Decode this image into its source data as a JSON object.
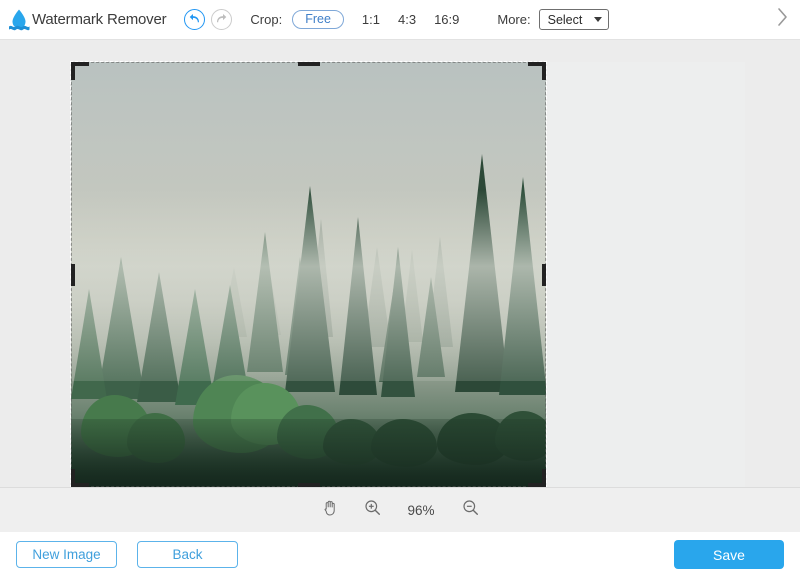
{
  "app": {
    "title": "Watermark Remover",
    "logo_icon": "water-drop-icon",
    "accent_color": "#29a6ec"
  },
  "toolbar": {
    "undo_icon": "undo-arrow-icon",
    "redo_icon": "redo-arrow-icon",
    "crop_label": "Crop:",
    "ratios": [
      {
        "label": "Free",
        "selected": true
      },
      {
        "label": "1:1",
        "selected": false
      },
      {
        "label": "4:3",
        "selected": false
      },
      {
        "label": "16:9",
        "selected": false
      }
    ],
    "more_label": "More:",
    "more_select_value": "Select",
    "more_select_caret_icon": "chevron-down-icon",
    "next_icon": "chevron-right-icon"
  },
  "canvas": {
    "image_alt": "Misty forest with pine trees",
    "crop_selection": {
      "handles": 8,
      "border_style": "dashed"
    }
  },
  "zoombar": {
    "hand_icon": "hand-pan-icon",
    "zoom_in_icon": "magnifier-plus-icon",
    "zoom_level": "96%",
    "zoom_out_icon": "magnifier-minus-icon"
  },
  "footer": {
    "new_image_label": "New Image",
    "back_label": "Back",
    "save_label": "Save"
  }
}
